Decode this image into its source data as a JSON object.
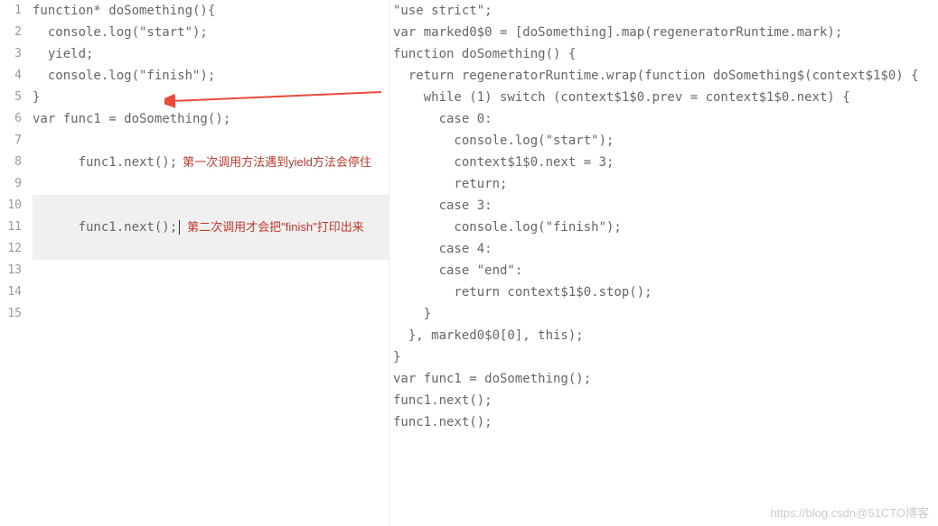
{
  "gutter_lines": [
    "1",
    "2",
    "3",
    "4",
    "5",
    "6",
    "7",
    "8",
    "9",
    "10",
    "11",
    "12",
    "13",
    "14",
    "15"
  ],
  "left_code": {
    "l1": "function* doSomething(){",
    "l2": "",
    "l3": "  console.log(\"start\");",
    "l4": "",
    "l5": "  yield;",
    "l6": "",
    "l7": "  console.log(\"finish\");",
    "l8": "",
    "l9": "}",
    "l10": "",
    "l11": "var func1 = doSomething();",
    "l12": "",
    "l13": "func1.next();",
    "l14": "",
    "l15": "func1.next();"
  },
  "annotations": {
    "a13": "第一次调用方法遇到yield方法会停住",
    "a15": "第二次调用才会把\"finish\"打印出来"
  },
  "right_code": {
    "r1": "\"use strict\";",
    "r2": "",
    "r3": "var marked0$0 = [doSomething].map(regeneratorRuntime.mark);",
    "r4": "function doSomething() {",
    "r5": "  return regeneratorRuntime.wrap(function doSomething$(context$1$0) {",
    "r6": "    while (1) switch (context$1$0.prev = context$1$0.next) {",
    "r7": "      case 0:",
    "r8": "",
    "r9": "        console.log(\"start\");",
    "r10": "",
    "r11": "        context$1$0.next = 3;",
    "r12": "        return;",
    "r13": "",
    "r14": "      case 3:",
    "r15": "",
    "r16": "        console.log(\"finish\");",
    "r17": "",
    "r18": "      case 4:",
    "r19": "      case \"end\":",
    "r20": "        return context$1$0.stop();",
    "r21": "    }",
    "r22": "  }, marked0$0[0], this);",
    "r23": "}",
    "r24": "",
    "r25": "var func1 = doSomething();",
    "r26": "",
    "r27": "func1.next();",
    "r28": "",
    "r29": "func1.next();"
  },
  "watermark": "https://blog.csdn@51CTO博客"
}
